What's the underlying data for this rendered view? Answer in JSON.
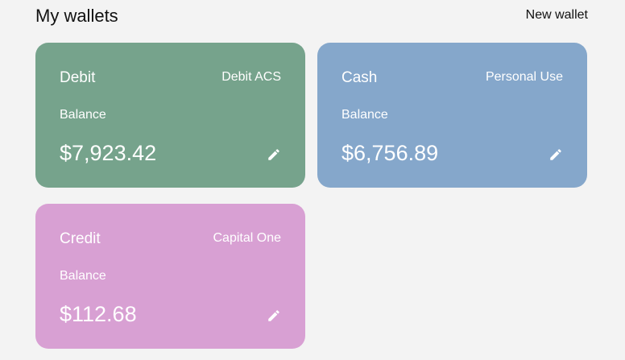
{
  "page": {
    "title": "My wallets",
    "new_wallet_label": "New wallet"
  },
  "wallets": [
    {
      "name": "Debit",
      "institution": "Debit ACS",
      "balance_label": "Balance",
      "amount": "$7,923.42",
      "color": "#76a38c",
      "edit_icon": "pencil-icon"
    },
    {
      "name": "Cash",
      "institution": "Personal Use",
      "balance_label": "Balance",
      "amount": "$6,756.89",
      "color": "#85a7cb",
      "edit_icon": "pencil-icon"
    },
    {
      "name": "Credit",
      "institution": "Capital One",
      "balance_label": "Balance",
      "amount": "$112.68",
      "color": "#d8a0d3",
      "edit_icon": "pencil-icon"
    }
  ]
}
